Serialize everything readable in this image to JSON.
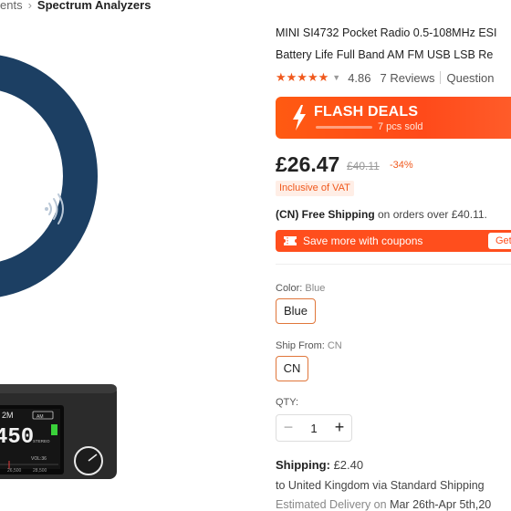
{
  "breadcrumb": {
    "partial": "ents",
    "current": "Spectrum Analyzers"
  },
  "product": {
    "title_line1": "MINI SI4732 Pocket Radio 0.5-108MHz ESI",
    "title_line2": "Battery Life Full Band AM FM USB LSB Re",
    "rating": "4.86",
    "reviews": "7 Reviews",
    "questions": "Question"
  },
  "flash": {
    "title": "FLASH DEALS",
    "sold": "7 pcs sold"
  },
  "price": {
    "current": "£26.47",
    "original": "£40.11",
    "discount": "-34%",
    "vat": "Inclusive of VAT"
  },
  "shipping_promo": {
    "bold": "(CN) Free Shipping",
    "rest": " on orders over £40.11."
  },
  "coupon": {
    "text": "Save more with coupons",
    "button": "Get"
  },
  "color": {
    "label": "Color:",
    "value": "Blue",
    "option": "Blue"
  },
  "ship_from": {
    "label": "Ship From:",
    "value": "CN",
    "option": "CN"
  },
  "qty": {
    "label": "QTY:",
    "minus": "−",
    "value": "1",
    "plus": "+"
  },
  "shipping": {
    "label": "Shipping:",
    "value": "£2.40",
    "to_line": "to United Kingdom via Standard Shipping",
    "est_label": "Estimated Delivery on",
    "est_dates": "Mar 26th-Apr 5th,20"
  },
  "device": {
    "freq_prefix": "2M",
    "freq": "450",
    "scale_a": "26,500",
    "scale_b": "28,500",
    "vol": "VOL:36",
    "mode_a": "AM",
    "mode_b": "STEREO"
  },
  "colors": {
    "accent": "#f0591d",
    "flash_bg": "#ff5a12",
    "device_blue": "#1c3f63"
  }
}
